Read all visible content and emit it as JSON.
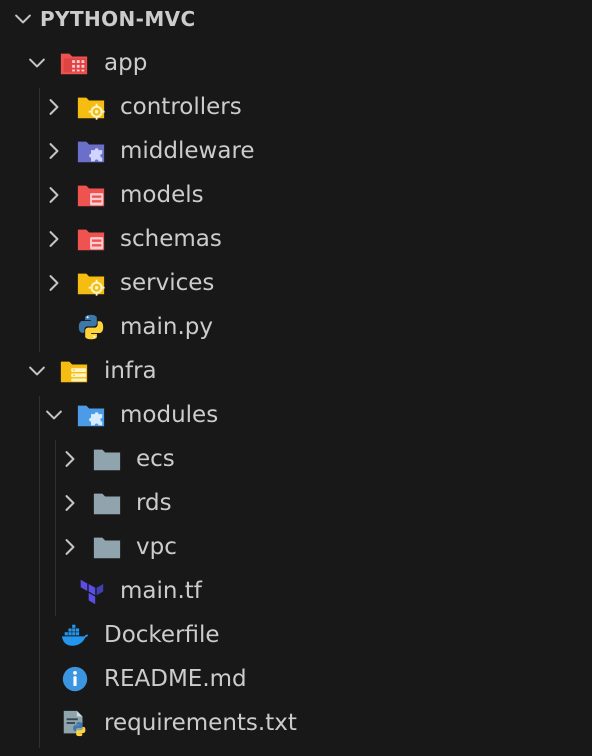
{
  "explorer": {
    "title": "PYTHON-MVC",
    "items": [
      {
        "label": "app",
        "kind": "folder",
        "icon": "app-folder-icon",
        "expanded": true
      },
      {
        "label": "controllers",
        "kind": "folder",
        "icon": "controllers-folder-icon",
        "expanded": false
      },
      {
        "label": "middleware",
        "kind": "folder",
        "icon": "middleware-folder-icon",
        "expanded": false
      },
      {
        "label": "models",
        "kind": "folder",
        "icon": "models-folder-icon",
        "expanded": false
      },
      {
        "label": "schemas",
        "kind": "folder",
        "icon": "schemas-folder-icon",
        "expanded": false
      },
      {
        "label": "services",
        "kind": "folder",
        "icon": "services-folder-icon",
        "expanded": false
      },
      {
        "label": "main.py",
        "kind": "file",
        "icon": "python-icon"
      },
      {
        "label": "infra",
        "kind": "folder",
        "icon": "infra-folder-icon",
        "expanded": true
      },
      {
        "label": "modules",
        "kind": "folder",
        "icon": "modules-folder-icon",
        "expanded": true
      },
      {
        "label": "ecs",
        "kind": "folder",
        "icon": "folder-icon",
        "expanded": false
      },
      {
        "label": "rds",
        "kind": "folder",
        "icon": "folder-icon",
        "expanded": false
      },
      {
        "label": "vpc",
        "kind": "folder",
        "icon": "folder-icon",
        "expanded": false
      },
      {
        "label": "main.tf",
        "kind": "file",
        "icon": "terraform-icon"
      },
      {
        "label": "Dockerfile",
        "kind": "file",
        "icon": "docker-icon"
      },
      {
        "label": "README.md",
        "kind": "file",
        "icon": "info-icon"
      },
      {
        "label": "requirements.txt",
        "kind": "file",
        "icon": "python-requirements-icon"
      }
    ]
  },
  "colors": {
    "background": "#181818",
    "text": "#cccccc",
    "chevron": "#c5c5c5",
    "yellow_folder": "#f5bd11",
    "red_folder": "#ef5350",
    "purple_folder": "#6c6fc9",
    "blue_folder": "#4c9be8",
    "grey_folder": "#90a4ae",
    "python_blue": "#3c78aa",
    "python_yellow": "#ffd43b",
    "terraform": "#5c4ee5",
    "docker": "#2496ed",
    "info": "#3b95e0"
  }
}
